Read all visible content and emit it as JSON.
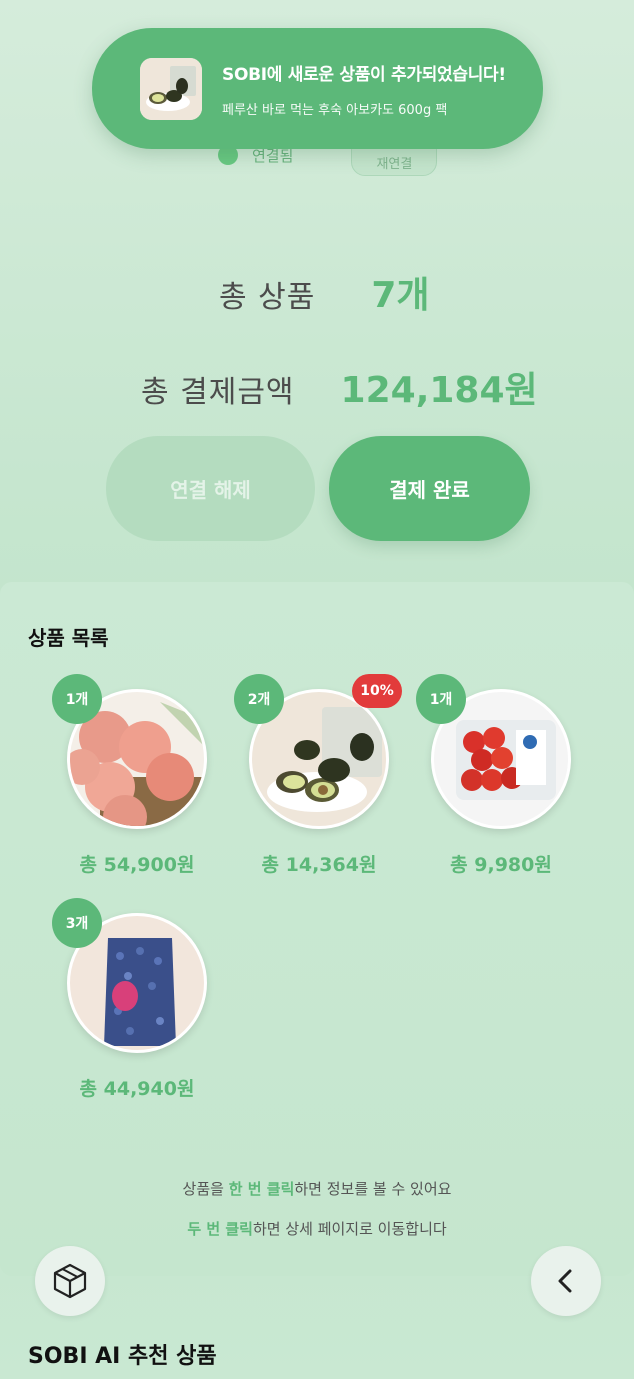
{
  "toast": {
    "title": "SOBI에 새로운 상품이 추가되었습니다!",
    "subtitle": "페루산 바로 먹는 후숙 아보카도 600g 팩"
  },
  "connection": {
    "status": "연결됨",
    "reconnect_label": "재연결"
  },
  "summary": {
    "total_items_label": "총 상품",
    "total_items_value": "7개",
    "total_price_label": "총 결제금액",
    "total_price_value": "124,184원"
  },
  "actions": {
    "disconnect_label": "연결 해제",
    "complete_label": "결제 완료"
  },
  "product_list": {
    "title": "상품 목록",
    "items": [
      {
        "qty": "1개",
        "total": "총 54,900원",
        "discount": ""
      },
      {
        "qty": "2개",
        "total": "총 14,364원",
        "discount": "10%"
      },
      {
        "qty": "1개",
        "total": "총 9,980원",
        "discount": ""
      },
      {
        "qty": "3개",
        "total": "총 44,940원",
        "discount": ""
      }
    ],
    "hint_line1_a": "상품을 ",
    "hint_line1_hl": "한 번 클릭",
    "hint_line1_b": "하면 정보를 볼 수 있어요",
    "hint_line2_hl": "두 번 클릭",
    "hint_line2_b": "하면 상세 페이지로 이동합니다"
  },
  "recommend": {
    "title": "SOBI AI 추천 상품"
  },
  "icons": {
    "box": "box-icon",
    "back": "chevron-left-icon"
  }
}
